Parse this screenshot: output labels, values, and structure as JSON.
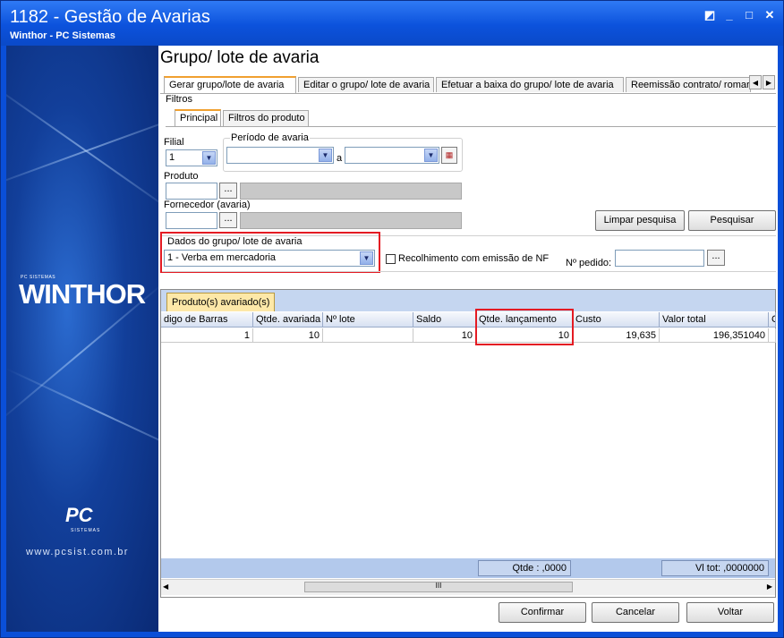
{
  "window": {
    "title": "1182 - Gestão de Avarias",
    "subtitle": "Winthor - PC Sistemas",
    "controls": {
      "restore": "◩",
      "minimize": "_",
      "maximize": "□",
      "close": "✕"
    }
  },
  "sidebar": {
    "brand_small": "PC SISTEMAS",
    "brand": "WINTHOR",
    "logo": "PC",
    "logo_sub": "SISTEMAS",
    "url": "www.pcsist.com.br"
  },
  "page": {
    "title": "Grupo/ lote de avaria"
  },
  "tabs": [
    {
      "label": "Gerar grupo/lote de avaria"
    },
    {
      "label": "Editar o grupo/ lote de avaria"
    },
    {
      "label": "Efetuar a baixa do grupo/ lote de avaria"
    },
    {
      "label": "Reemissão contrato/ romar"
    }
  ],
  "filtros": {
    "label": "Filtros",
    "subtabs": [
      {
        "label": "Principal"
      },
      {
        "label": "Filtros do produto"
      }
    ],
    "filial": {
      "label": "Filial",
      "value": "1"
    },
    "periodo": {
      "label": "Período de avaria",
      "separator": "a",
      "start": "",
      "end": ""
    },
    "produto": {
      "label": "Produto",
      "code": "",
      "description": ""
    },
    "fornecedor": {
      "label": "Fornecedor (avaria)",
      "code": "",
      "description": ""
    },
    "ellipsis": "...",
    "limpar_label": "Limpar pesquisa",
    "pesquisar_label": "Pesquisar"
  },
  "dados": {
    "label": "Dados do grupo/ lote de avaria",
    "value": "1 - Verba em mercadoria",
    "recolhimento_label": "Recolhimento com emissão de NF",
    "recolhimento_checked": false,
    "pedido_label": "Nº pedido:",
    "pedido_value": ""
  },
  "grid": {
    "tab_label": "Produto(s) avariado(s)",
    "columns": [
      "digo de Barras",
      "Qtde. avariada",
      "Nº lote",
      "Saldo",
      "Qtde. lançamento",
      "Custo",
      "Valor total",
      "C"
    ],
    "rows": [
      [
        "1",
        "10",
        "",
        "10",
        "10",
        "19,635",
        "196,351040",
        ""
      ]
    ],
    "qtde_total": "Qtde :  ,0000",
    "vl_total": "Vl tot: ,0000000",
    "scroll_grip": "III"
  },
  "footer": {
    "confirmar_label": "Confirmar",
    "cancelar_label": "Cancelar",
    "voltar_label": "Voltar"
  }
}
